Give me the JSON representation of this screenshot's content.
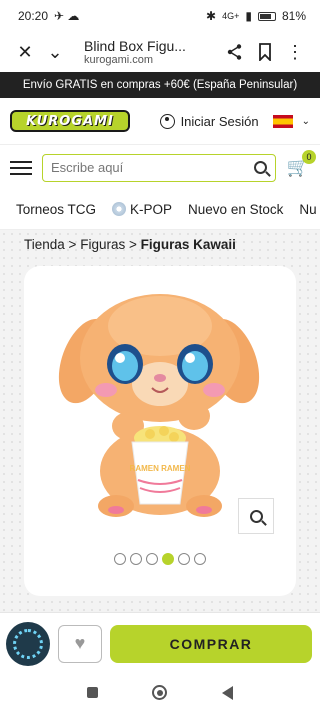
{
  "status_bar": {
    "time": "20:20",
    "signal": "4G+",
    "battery": "81%"
  },
  "browser": {
    "title": "Blind Box Figu...",
    "url": "kurogami.com"
  },
  "promo": {
    "text": "Envío GRATIS en compras +60€ (España Peninsular)"
  },
  "header": {
    "logo_text": "KUROGAMI",
    "login_label": "Iniciar Sesión",
    "flag_icon": "spain-flag-icon"
  },
  "search": {
    "placeholder": "Escribe aquí",
    "cart_count": "0"
  },
  "categories": [
    "Torneos TCG",
    "K-POP",
    "Nuevo en Stock",
    "Nu"
  ],
  "breadcrumb": {
    "items": [
      "Tienda",
      "Figuras"
    ],
    "current": "Figuras Kawaii",
    "separator": ">"
  },
  "product": {
    "cup_text": "RAMEN RAMEN",
    "gallery_count": 6,
    "gallery_active_index": 4
  },
  "actions": {
    "buy_label": "COMPRAR"
  },
  "colors": {
    "accent": "#b7d32b",
    "promo_bg": "#222222"
  }
}
